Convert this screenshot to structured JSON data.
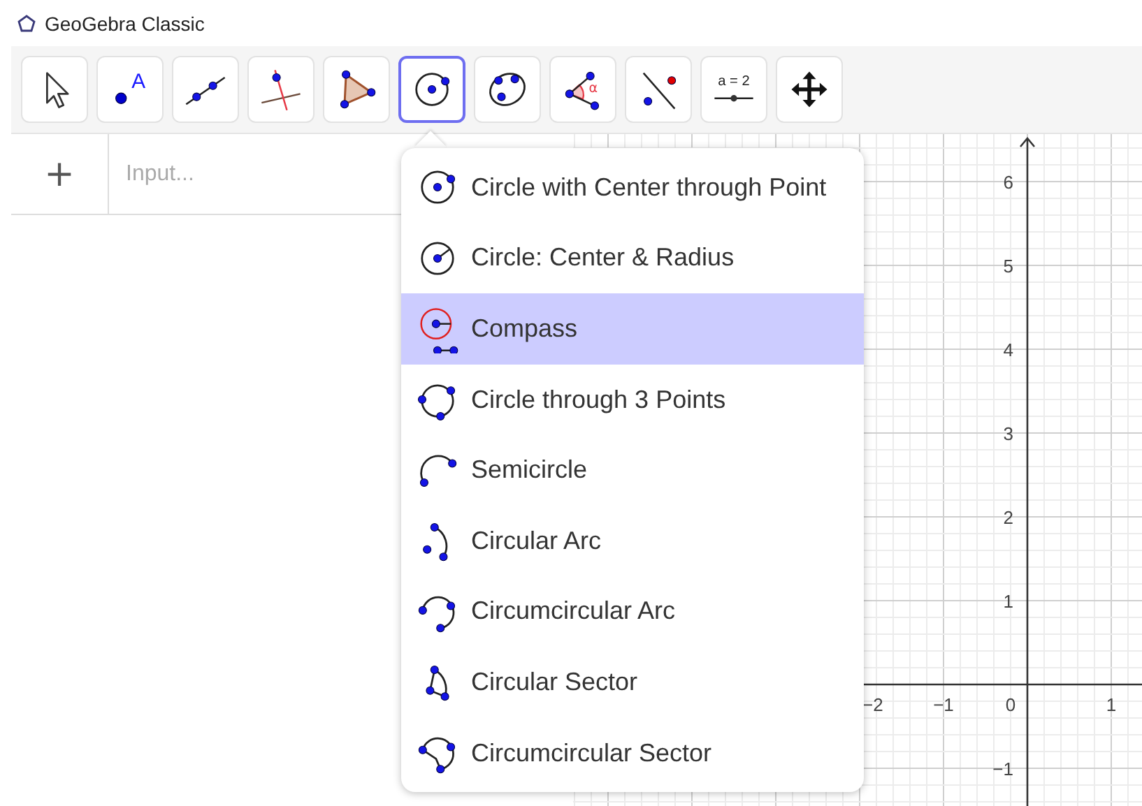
{
  "window": {
    "title": "GeoGebra Classic"
  },
  "toolbar": [
    {
      "kind": "move",
      "selected": false
    },
    {
      "kind": "point",
      "glyph": "A",
      "selected": false
    },
    {
      "kind": "line",
      "selected": false
    },
    {
      "kind": "perpendicular",
      "selected": false
    },
    {
      "kind": "polygon",
      "selected": false
    },
    {
      "kind": "circle",
      "selected": true
    },
    {
      "kind": "conic",
      "selected": false
    },
    {
      "kind": "angle",
      "glyph": "α",
      "selected": false
    },
    {
      "kind": "reflect",
      "selected": false
    },
    {
      "kind": "slider",
      "glyph": "a = 2",
      "selected": false
    },
    {
      "kind": "move-view",
      "selected": false
    }
  ],
  "algebra_view": {
    "add_button": "+",
    "input": {
      "placeholder": "Input..."
    }
  },
  "tool_menu": [
    {
      "kind": "circle-center-point",
      "label": "Circle with Center through Point",
      "selected": false
    },
    {
      "kind": "circle-radius",
      "label": "Circle: Center & Radius",
      "selected": false
    },
    {
      "kind": "compass",
      "label": "Compass",
      "selected": true
    },
    {
      "kind": "circle-3-points",
      "label": "Circle through 3 Points",
      "selected": false
    },
    {
      "kind": "semicircle",
      "label": "Semicircle",
      "selected": false
    },
    {
      "kind": "arc",
      "label": "Circular Arc",
      "selected": false
    },
    {
      "kind": "circumcircular-arc",
      "label": "Circumcircular Arc",
      "selected": false
    },
    {
      "kind": "sector",
      "label": "Circular Sector",
      "selected": false
    },
    {
      "kind": "circumcircular-sector",
      "label": "Circumcircular Sector",
      "selected": false
    }
  ],
  "graphics_view": {
    "x_labels": [
      "−2",
      "−1",
      "0",
      "1"
    ],
    "y_labels": [
      "6",
      "5",
      "4",
      "3",
      "2",
      "1",
      "−1"
    ]
  }
}
